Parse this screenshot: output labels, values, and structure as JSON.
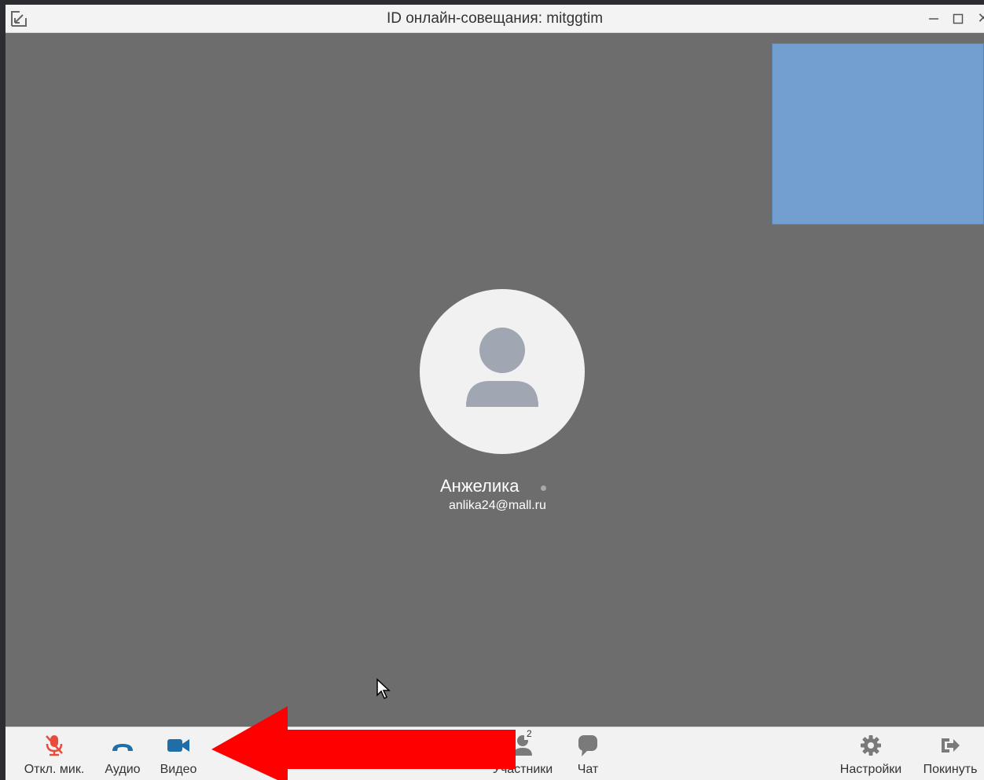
{
  "window": {
    "title": "ID онлайн-совещания: mitggtim",
    "close_glyph": "✕"
  },
  "participant": {
    "name": "Анжелика",
    "email": "anlika24@mall.ru"
  },
  "toolbar": {
    "mute_label": "Откл. мик.",
    "audio_label": "Аудио",
    "video_label": "Видео",
    "participants_label": "Участники",
    "participants_count": "2",
    "chat_label": "Чат",
    "settings_label": "Настройки",
    "leave_label": "Покинуть"
  },
  "colors": {
    "mute_icon": "#e84c3d",
    "audio_icon": "#1f6ea8",
    "video_icon": "#1f6ea8",
    "annotation_arrow": "#ff0000",
    "self_preview": "#729fd0"
  },
  "icons": {
    "collapse": "collapse-arrow-icon",
    "mute": "microphone-off-icon",
    "audio": "phone-icon",
    "video": "video-camera-icon",
    "participants": "person-icon",
    "chat": "chat-bubble-icon",
    "settings": "gear-icon",
    "leave": "exit-icon"
  }
}
